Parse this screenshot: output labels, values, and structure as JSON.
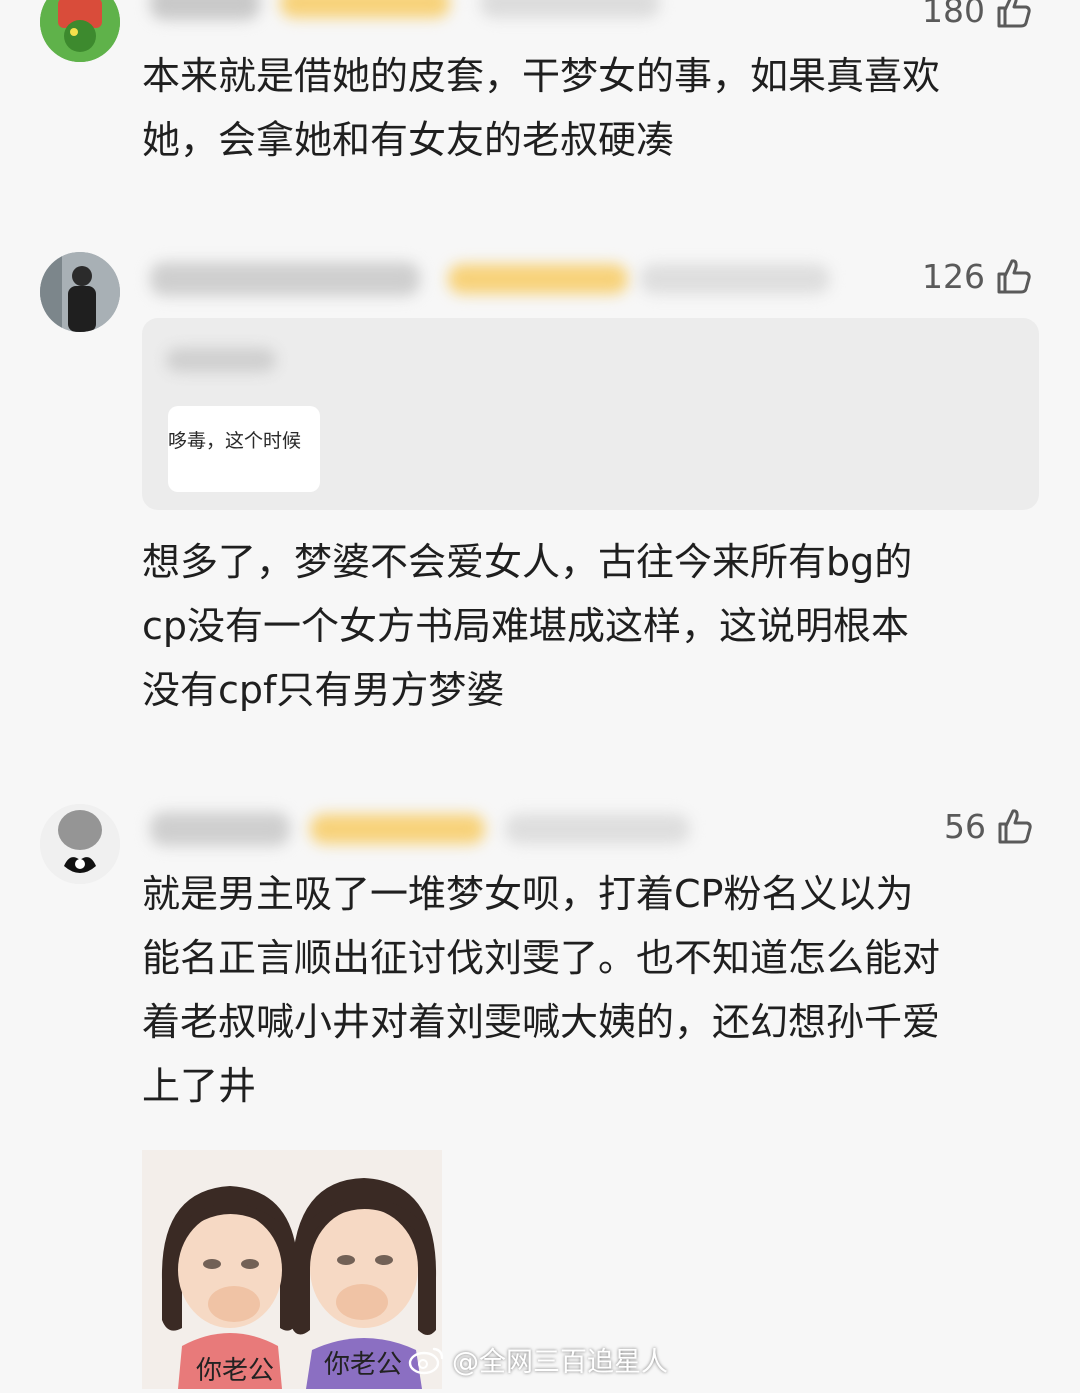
{
  "comments": [
    {
      "likes": "180",
      "lines": [
        "本来就是借她的皮套，干梦女的事，如果真喜欢",
        "她，会拿她和有女友的老叔硬凑"
      ]
    },
    {
      "likes": "126",
      "quoted_snippet": "哆毒，这个时候",
      "lines": [
        "想多了，梦婆不会爱女人，古往今来所有bg的",
        "cp没有一个女方书局难堪成这样，这说明根本",
        "没有cpf只有男方梦婆"
      ]
    },
    {
      "likes": "56",
      "lines": [
        "就是男主吸了一堆梦女呗，打着CP粉名义以为",
        "能名正言顺出征讨伐刘雯了。也不知道怎么能对",
        "着老叔喊小井对着刘雯喊大姨的，还幻想孙千爱",
        "上了井"
      ],
      "sticker": {
        "left_label": "你老公",
        "right_label": "你老公"
      }
    }
  ],
  "watermark": "@全网三百追星人",
  "icons": {
    "like": "thumbs-up-icon",
    "watermark_logo": "weibo-logo-icon"
  },
  "colors": {
    "background": "#f7f7f7",
    "text": "#1f1f1f",
    "likes": "#5a5a5a",
    "badge": "#f7d27a"
  }
}
